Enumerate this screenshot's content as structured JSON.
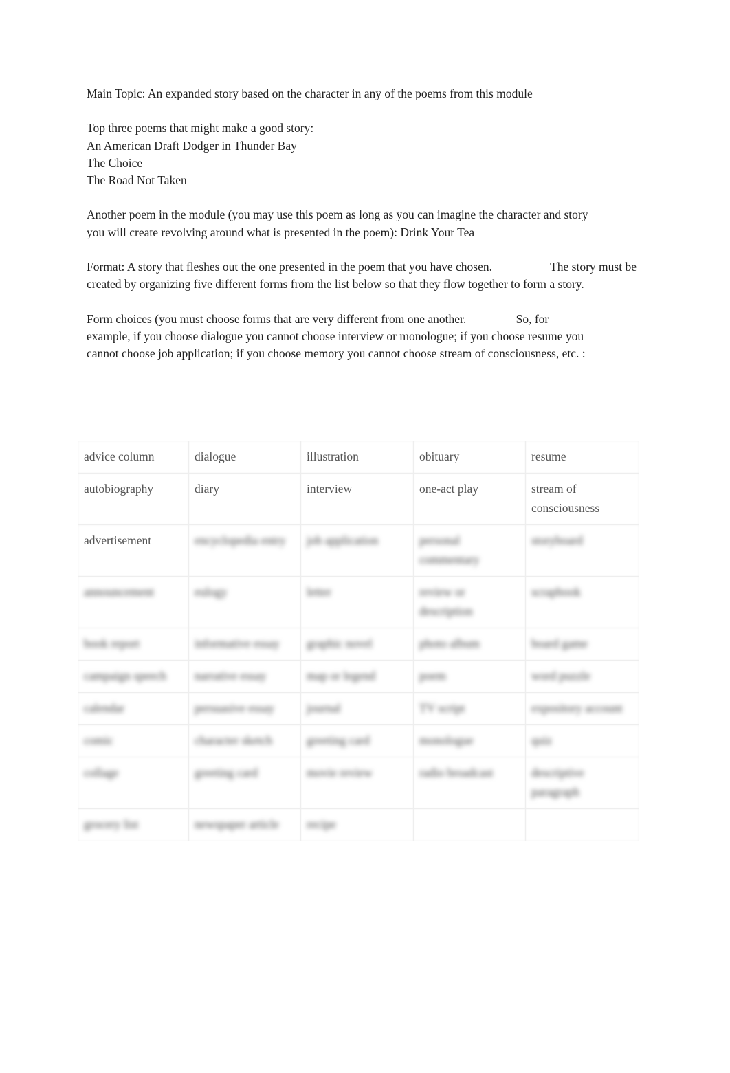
{
  "main_topic": "Main Topic: An expanded story based on the character in any of the poems from this module",
  "top_three": {
    "heading": "Top three poems that might make a good story:",
    "poems": [
      "An American Draft Dodger in Thunder Bay",
      "The Choice",
      "The Road Not Taken"
    ]
  },
  "another_poem": "Another poem in the module (you may use this poem as long as you can imagine the character and story you will create revolving around what is presented in the poem): Drink Your Tea",
  "format": {
    "part1": "Format: A story that fleshes out the one presented in the poem that you have chosen.",
    "part2": "The story must be created by organizing five different forms from the list below so that they flow together to form a story."
  },
  "form_choices": {
    "part1": "Form choices (you must choose forms that are very different from one another.",
    "part2": "So, for example, if you choose dialogue you cannot choose interview or monologue; if you choose resume you cannot choose job application; if you choose memory you cannot choose stream of consciousness, etc. :"
  },
  "table": {
    "rows": [
      [
        "advice column",
        "dialogue",
        "illustration",
        "obituary",
        "resume"
      ],
      [
        "autobiography",
        "diary",
        "interview",
        "one-act play",
        "stream of consciousness"
      ],
      [
        "advertisement",
        "encyclopedia entry",
        "job application",
        "personal commentary",
        "storyboard"
      ],
      [
        "announcement",
        "eulogy",
        "letter",
        "review or description",
        "scrapbook"
      ],
      [
        "book report",
        "informative essay",
        "graphic novel",
        "photo album",
        "board game"
      ],
      [
        "campaign speech",
        "narrative essay",
        "map or legend",
        "poem",
        "word puzzle"
      ],
      [
        "calendar",
        "persuasive essay",
        "journal",
        "TV script",
        "expository account"
      ],
      [
        "comic",
        "character sketch",
        "greeting card",
        "monologue",
        "quiz"
      ],
      [
        "collage",
        "greeting card",
        "movie review",
        "radio broadcast",
        "descriptive paragraph"
      ],
      [
        "grocery list",
        "newspaper article",
        "recipe",
        "",
        ""
      ]
    ],
    "blurred_from_row": 2,
    "clear_cells_in_row_2": 1
  }
}
